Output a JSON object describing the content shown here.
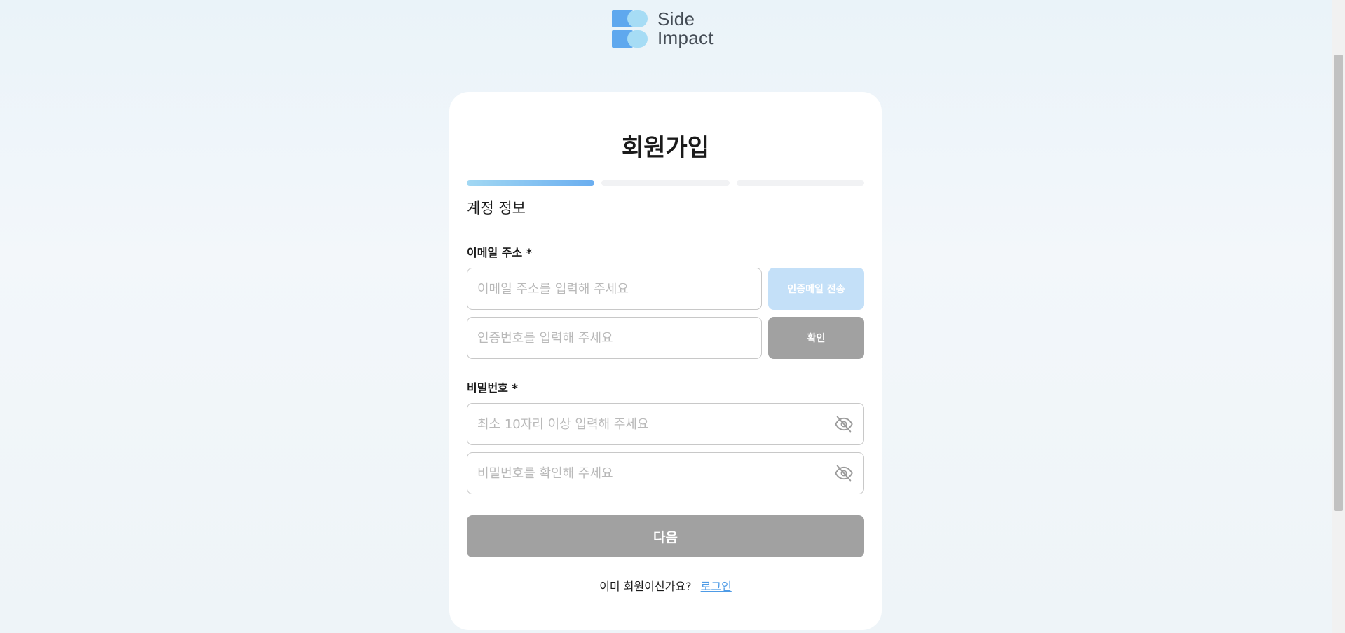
{
  "brand": {
    "line1": "Side",
    "line2": "Impact",
    "colors": {
      "primary": "#5fa8ee",
      "secondary": "#a6dcf5"
    }
  },
  "signup": {
    "title": "회원가입",
    "progress": {
      "total_steps": 3,
      "current_step": 1
    },
    "section_title": "계정 정보",
    "email": {
      "label": "이메일 주소 *",
      "placeholder": "이메일 주소를 입력해 주세요",
      "send_button": "인증메일 전송",
      "code_placeholder": "인증번호를 입력해 주세요",
      "confirm_button": "확인"
    },
    "password": {
      "label": "비밀번호 *",
      "placeholder": "최소 10자리 이상 입력해 주세요",
      "confirm_placeholder": "비밀번호를 확인해 주세요",
      "toggle_icon": "eye-off-icon"
    },
    "next_button": "다음",
    "footer": {
      "prompt": "이미 회원이신가요?",
      "login_link": "로그인"
    }
  }
}
